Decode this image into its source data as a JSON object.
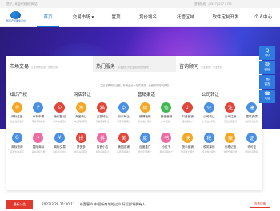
{
  "topbar": {
    "left": "您好，欢迎来到我们网站！",
    "right": "咨询热线：(0527) 237 0751"
  },
  "logo": {
    "text": "知识产权服务平台"
  },
  "nav": [
    {
      "label": "首页",
      "active": true
    },
    {
      "label": "交易市场 ▾",
      "active": false
    },
    {
      "label": "置顶",
      "active": false
    },
    {
      "label": "竞价域名",
      "active": false
    },
    {
      "label": "托管区域",
      "active": false
    },
    {
      "label": "软件定制开发",
      "active": false
    },
    {
      "label": "个人中心",
      "active": false
    }
  ],
  "panel": {
    "heads": [
      {
        "title": "市场交易",
        "sub": "汇聚优质资源，合规交易"
      },
      {
        "title": "热门服务",
        "sub": "专业团队为企业提供优质服务"
      },
      {
        "title": "咨询顾问",
        "sub": "专业服务，专业支持"
      }
    ],
    "notice": "立足互联网产业圈，布局全业一站式服务，全面保障知识产权",
    "columns": [
      {
        "title": "知识产权",
        "items": [
          {
            "name": "商标注册",
            "desc": "快速注册商标",
            "color": "#f5a623",
            "icon": "®"
          },
          {
            "name": "专利申请",
            "desc": "专利申请保护",
            "color": "#4a90e2",
            "icon": "P"
          },
          {
            "name": "版权登记",
            "desc": "软件版权登记",
            "color": "#e0463a",
            "icon": "©"
          },
          {
            "name": "商标查询",
            "desc": "实时查询商标",
            "color": "#4a90e2",
            "icon": "Q"
          },
          {
            "name": "国际商标",
            "desc": "海外商标注册",
            "color": "#f06ca0",
            "icon": "✈"
          },
          {
            "name": "商标交易",
            "desc": "商标转让过户",
            "color": "#4a90e2",
            "icon": "¥"
          }
        ]
      },
      {
        "title": "网店转让",
        "items": [
          {
            "name": "淘宝转让",
            "desc": "淘宝网店转让",
            "color": "#f5a623",
            "icon": "淘"
          },
          {
            "name": "天猫转让",
            "desc": "天猫店铺转让",
            "color": "#e0463a",
            "icon": "猫"
          },
          {
            "name": "京东转让",
            "desc": "京东店铺转让",
            "color": "#4a90e2",
            "icon": "京"
          },
          {
            "name": "拼多多",
            "desc": "拼多多店转让",
            "color": "#e0463a",
            "icon": "拼"
          },
          {
            "name": "抖音小店",
            "desc": "抖音店铺转让",
            "color": "#f06ca0",
            "icon": "抖"
          },
          {
            "name": "美团店铺",
            "desc": "美团店铺转让",
            "color": "#e0463a",
            "icon": "美"
          }
        ]
      },
      {
        "title": "营销渠道",
        "items": [
          {
            "name": "微博营销",
            "desc": "微博推广服务",
            "color": "#f5a623",
            "icon": "微"
          },
          {
            "name": "微信营销",
            "desc": "公众号推广",
            "color": "#3fb950",
            "icon": "信"
          },
          {
            "name": "抖音营销",
            "desc": "短视频推广",
            "color": "#e0463a",
            "icon": "♪"
          },
          {
            "name": "百度推广",
            "desc": "搜索引擎推广",
            "color": "#4a90e2",
            "icon": "度"
          },
          {
            "name": "小红书",
            "desc": "种草营销推广",
            "color": "#f06ca0",
            "icon": "书"
          },
          {
            "name": "快手营销",
            "desc": "快手推广服务",
            "color": "#f5a623",
            "icon": "快"
          }
        ]
      },
      {
        "title": "公司转让",
        "items": [
          {
            "name": "公司转让",
            "desc": "公司过户转让",
            "color": "#4a90e2",
            "icon": "公"
          },
          {
            "name": "公司注册",
            "desc": "工商注册服务",
            "color": "#e0463a",
            "icon": "注"
          },
          {
            "name": "建筑资质",
            "desc": "资质转让办理",
            "color": "#4a90e2",
            "icon": "建"
          },
          {
            "name": "税务筹划",
            "desc": "专业税务服务",
            "color": "#4a90e2",
            "icon": "税"
          },
          {
            "name": "代理记账",
            "desc": "财务代理记账",
            "color": "#f5a623",
            "icon": "账"
          },
          {
            "name": "许可证",
            "desc": "经营许可办理",
            "color": "#4a90e2",
            "icon": "证"
          }
        ]
      }
    ]
  },
  "side": [
    {
      "icon": "Q",
      "label": "QQ"
    },
    {
      "icon": "微",
      "label": "微信"
    },
    {
      "icon": "✉",
      "label": "留言"
    },
    {
      "icon": "☎",
      "label": "电话"
    }
  ],
  "bottom": {
    "badge": "最新公告",
    "date": "2022/3/29 21:30:11",
    "text": "恭喜客户 中国新商域的过户 好运即将拥有人",
    "more": "查看详情"
  }
}
